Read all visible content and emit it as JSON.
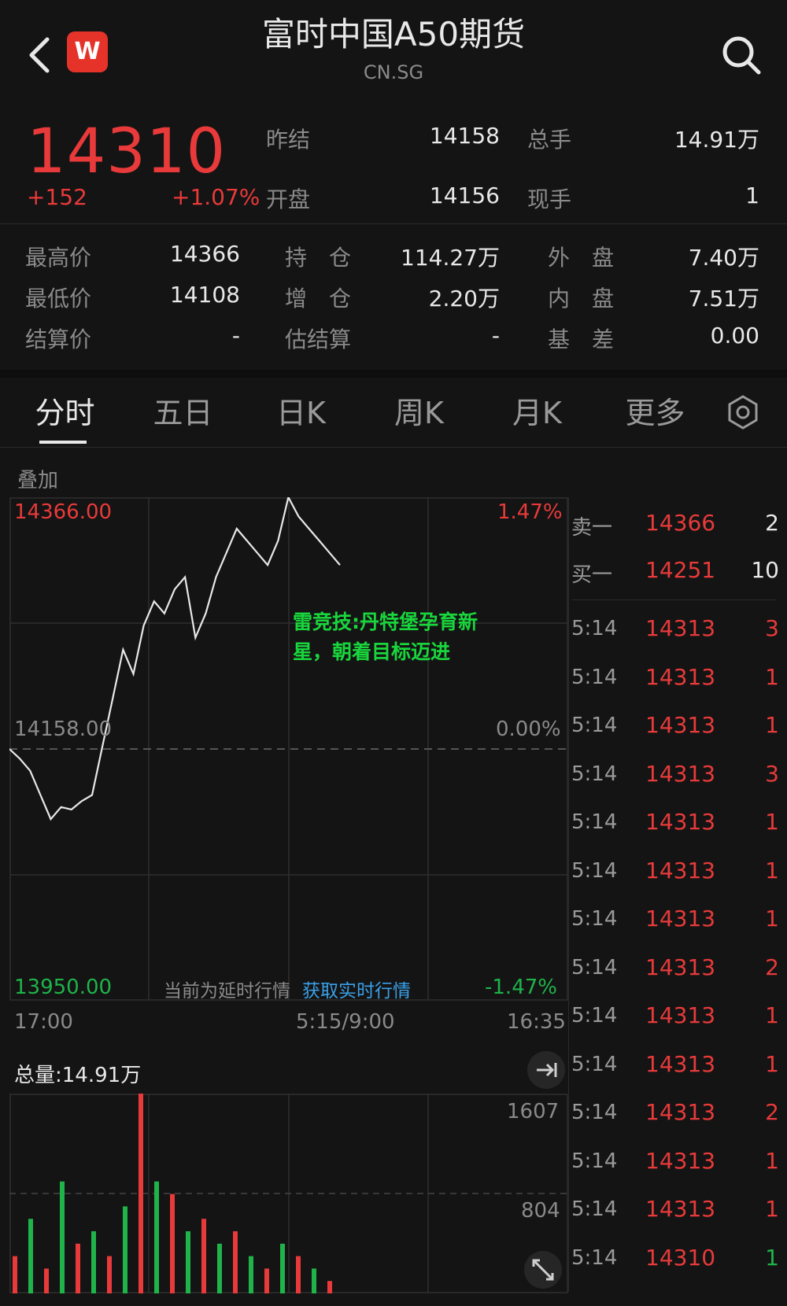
{
  "header": {
    "title": "富时中国A50期货",
    "subtitle": "CN.SG",
    "logo_letter": "W"
  },
  "quote": {
    "price": "14310",
    "change": "+152",
    "change_pct": "+1.07%",
    "stats_top": [
      {
        "label": "昨结",
        "value": "14158"
      },
      {
        "label": "总手",
        "value": "14.91万"
      },
      {
        "label": "开盘",
        "value": "14156"
      },
      {
        "label": "现手",
        "value": "1"
      }
    ],
    "stats": [
      {
        "label": "最高价",
        "value": "14366"
      },
      {
        "label": "持　仓",
        "value": "114.27万"
      },
      {
        "label": "外　盘",
        "value": "7.40万"
      },
      {
        "label": "最低价",
        "value": "14108"
      },
      {
        "label": "增　仓",
        "value": "2.20万"
      },
      {
        "label": "内　盘",
        "value": "7.51万"
      },
      {
        "label": "结算价",
        "value": "-"
      },
      {
        "label": "估结算",
        "value": "-"
      },
      {
        "label": "基　差",
        "value": "0.00"
      }
    ]
  },
  "tabs": [
    "分时",
    "五日",
    "日K",
    "周K",
    "月K",
    "更多"
  ],
  "chart": {
    "overlay_label": "叠加",
    "y_high": "14366.00",
    "y_mid": "14158.00",
    "y_low": "13950.00",
    "pct_high": "1.47%",
    "pct_mid": "0.00%",
    "pct_low": "-1.47%",
    "x_start": "17:00",
    "x_mid": "5:15/9:00",
    "x_end": "16:35",
    "delay_note": "当前为延时行情",
    "realtime_link": "获取实时行情",
    "watermark": "雷竞技:丹特堡孕育新星，朝着目标迈进",
    "volume_label": "总量:14.91万",
    "vol_high": "1607",
    "vol_mid": "804"
  },
  "chart_data": {
    "type": "line",
    "x": [
      "17:00",
      "5:15/9:00",
      "16:35"
    ],
    "ylim": [
      13950,
      14366
    ],
    "series": [
      {
        "values": [
          14158,
          14150,
          14140,
          14120,
          14100,
          14110,
          14108,
          14115,
          14120,
          14160,
          14200,
          14240,
          14220,
          14260,
          14280,
          14270,
          14290,
          14300,
          14250,
          14270,
          14300,
          14320,
          14340,
          14330,
          14320,
          14310,
          14330,
          14366,
          14350,
          14340,
          14330,
          14320,
          14310
        ]
      }
    ],
    "volume": [
      300,
      600,
      200,
      900,
      400,
      500,
      300,
      700,
      1607,
      900,
      800,
      500,
      600,
      400,
      500,
      300,
      200,
      400,
      300,
      200,
      100
    ]
  },
  "orderbook": {
    "ask": {
      "label": "卖一",
      "price": "14366",
      "qty": "2"
    },
    "bid": {
      "label": "买一",
      "price": "14251",
      "qty": "10"
    },
    "trades": [
      {
        "time": "5:14",
        "price": "14313",
        "qty": "3"
      },
      {
        "time": "5:14",
        "price": "14313",
        "qty": "1"
      },
      {
        "time": "5:14",
        "price": "14313",
        "qty": "1"
      },
      {
        "time": "5:14",
        "price": "14313",
        "qty": "3"
      },
      {
        "time": "5:14",
        "price": "14313",
        "qty": "1"
      },
      {
        "time": "5:14",
        "price": "14313",
        "qty": "1"
      },
      {
        "time": "5:14",
        "price": "14313",
        "qty": "1"
      },
      {
        "time": "5:14",
        "price": "14313",
        "qty": "2"
      },
      {
        "time": "5:14",
        "price": "14313",
        "qty": "1"
      },
      {
        "time": "5:14",
        "price": "14313",
        "qty": "1"
      },
      {
        "time": "5:14",
        "price": "14313",
        "qty": "2"
      },
      {
        "time": "5:14",
        "price": "14313",
        "qty": "1"
      },
      {
        "time": "5:14",
        "price": "14313",
        "qty": "1"
      },
      {
        "time": "5:14",
        "price": "14310",
        "qty": "1"
      }
    ]
  },
  "colors": {
    "up": "#e83a3a",
    "down": "#1fb34a",
    "bg": "#141414"
  }
}
